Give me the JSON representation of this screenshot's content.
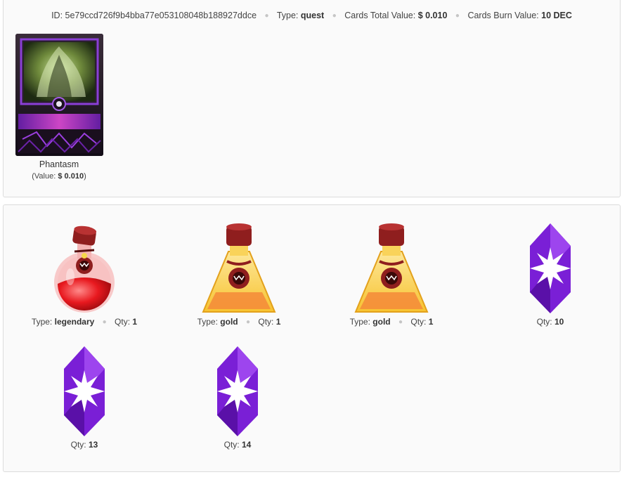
{
  "summary": {
    "id_label": "ID:",
    "id_value": "5e79ccd726f9b4bba77e053108048b188927ddce",
    "type_label": "Type:",
    "type_value": "quest",
    "total_label": "Cards Total Value:",
    "total_value": "$ 0.010",
    "burn_label": "Cards Burn Value:",
    "burn_value": "10 DEC"
  },
  "card": {
    "name": "Phantasm",
    "value_prefix": "(Value:",
    "value_amount": "$ 0.010",
    "value_suffix": ")"
  },
  "rewards": [
    {
      "icon": "legendary-potion-icon",
      "type_label": "Type:",
      "type_value": "legendary",
      "qty_label": "Qty:",
      "qty_value": "1"
    },
    {
      "icon": "gold-potion-icon",
      "type_label": "Type:",
      "type_value": "gold",
      "qty_label": "Qty:",
      "qty_value": "1"
    },
    {
      "icon": "gold-potion-icon",
      "type_label": "Type:",
      "type_value": "gold",
      "qty_label": "Qty:",
      "qty_value": "1"
    },
    {
      "icon": "dec-crystal-icon",
      "qty_label": "Qty:",
      "qty_value": "10"
    },
    {
      "icon": "dec-crystal-icon",
      "qty_label": "Qty:",
      "qty_value": "13"
    },
    {
      "icon": "dec-crystal-icon",
      "qty_label": "Qty:",
      "qty_value": "14"
    }
  ],
  "colors": {
    "crystal": "#7a1fd6",
    "legendary_potion": "#e8191f",
    "gold_potion": "#f7c330",
    "cork": "#8f1e1e"
  }
}
